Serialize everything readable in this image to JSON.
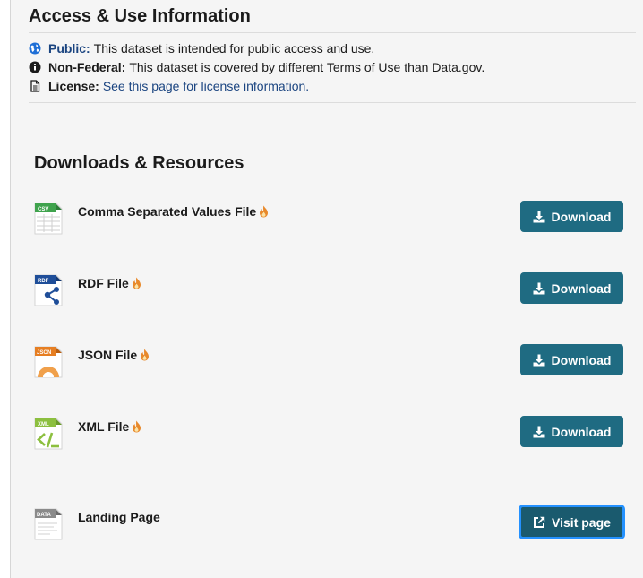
{
  "access": {
    "title": "Access & Use Information",
    "public": {
      "label": "Public:",
      "text": "This dataset is intended for public access and use."
    },
    "non_federal": {
      "label": "Non-Federal:",
      "text": "This dataset is covered by different Terms of Use than Data.gov."
    },
    "license": {
      "label": "License:",
      "link": "See this page for license information."
    }
  },
  "downloads": {
    "title": "Downloads & Resources",
    "resources": [
      {
        "title": "Comma Separated Values File",
        "icon_text": "CSV",
        "button": "Download",
        "icon": "csv-file-icon"
      },
      {
        "title": "RDF File",
        "icon_text": "RDF",
        "button": "Download",
        "icon": "rdf-file-icon"
      },
      {
        "title": "JSON File",
        "icon_text": "JSON",
        "button": "Download",
        "icon": "json-file-icon"
      },
      {
        "title": "XML File",
        "icon_text": "XML",
        "button": "Download",
        "icon": "xml-file-icon"
      },
      {
        "title": "Landing Page",
        "icon_text": "DATA",
        "button": "Visit page",
        "icon": "data-file-icon"
      }
    ]
  },
  "colors": {
    "button": "#1f6b82",
    "link": "#1a4480",
    "focus_ring": "#2491ff",
    "flame": "#e8892b"
  }
}
